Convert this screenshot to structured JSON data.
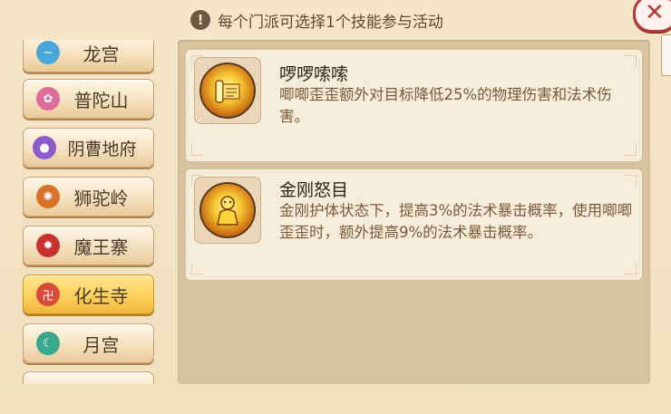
{
  "notice": {
    "icon": "exclamation-icon",
    "text": "每个门派可选择1个技能参与活动"
  },
  "close": {
    "label": "✕"
  },
  "sidebar": {
    "items": [
      {
        "label": "龙宫",
        "icon": "dragon-wave-emblem-icon",
        "color": "#4aa5d8"
      },
      {
        "label": "普陀山",
        "icon": "lotus-emblem-icon",
        "color": "#e06a9a"
      },
      {
        "label": "阴曹地府",
        "icon": "skull-emblem-icon",
        "color": "#8e5cc9"
      },
      {
        "label": "狮驼岭",
        "icon": "lion-emblem-icon",
        "color": "#d8742a"
      },
      {
        "label": "魔王寨",
        "icon": "demon-emblem-icon",
        "color": "#c8322e"
      },
      {
        "label": "化生寺",
        "icon": "temple-emblem-icon",
        "color": "#d84a3a",
        "active": true
      },
      {
        "label": "月宫",
        "icon": "moon-emblem-icon",
        "color": "#3aa88e"
      }
    ]
  },
  "skills": [
    {
      "name": "啰啰嗦嗦",
      "icon": "scroll-skill-icon",
      "description": "唧唧歪歪额外对目标降低25%的物理伤害和法术伤害。"
    },
    {
      "name": "金刚怒目",
      "icon": "golden-warrior-skill-icon",
      "description": "金刚护体状态下，提高3%的法术暴击概率，使用唧唧歪歪时，额外提高9%的法术暴击概率。"
    }
  ]
}
